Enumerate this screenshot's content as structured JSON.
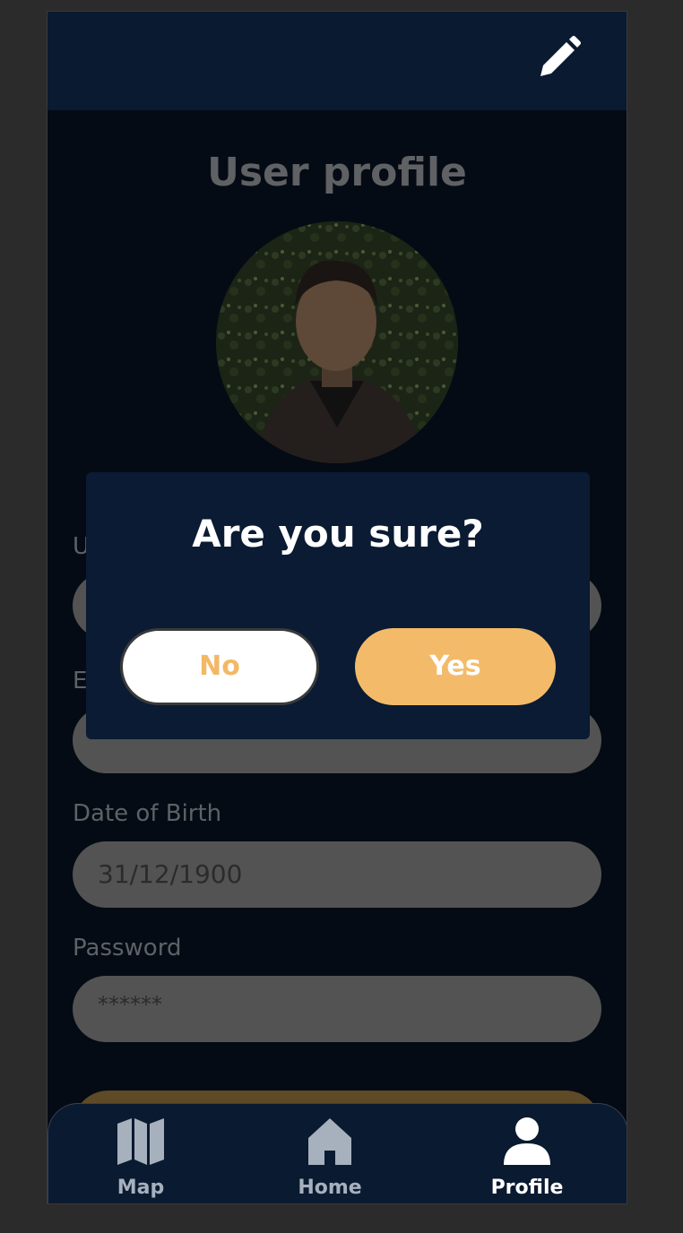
{
  "header": {
    "edit_icon": "pencil-icon"
  },
  "profile": {
    "title": "User profile",
    "fields": {
      "username": {
        "label_visible": "U",
        "value": ""
      },
      "email": {
        "label_visible": "E",
        "value": ""
      },
      "dob": {
        "label": "Date of Birth",
        "value": "31/12/1900"
      },
      "password": {
        "label": "Password",
        "value": "******"
      }
    }
  },
  "dialog": {
    "title": "Are you sure?",
    "no_label": "No",
    "yes_label": "Yes"
  },
  "tabs": [
    {
      "label": "Map",
      "icon": "map-icon",
      "active": false
    },
    {
      "label": "Home",
      "icon": "home-icon",
      "active": false
    },
    {
      "label": "Profile",
      "icon": "user-icon",
      "active": true
    }
  ],
  "colors": {
    "accent": "#f3bb69",
    "navy": "#0a1a30",
    "tab_inactive": "#a7b0bd",
    "tab_active": "#ffffff"
  }
}
